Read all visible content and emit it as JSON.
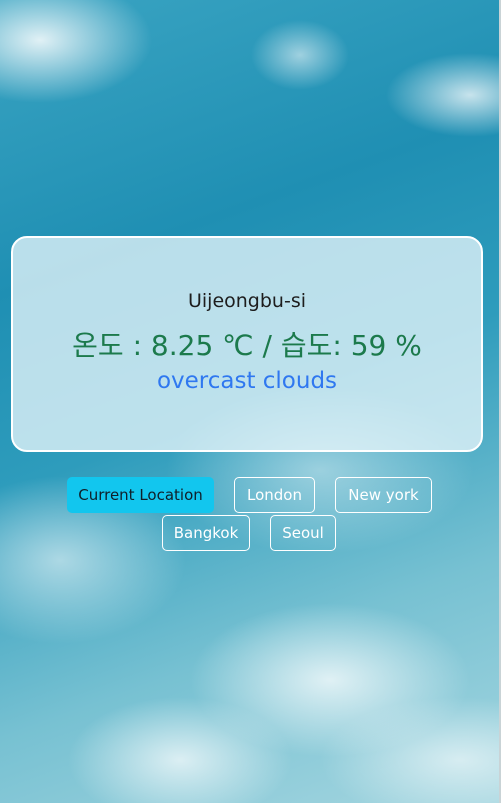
{
  "weather": {
    "city": "Uijeongbu-si",
    "temperature_line": "온도 : 8.25 ℃ / 습도: 59 %",
    "description": "overcast clouds"
  },
  "buttons": [
    {
      "label": "Current Location",
      "active": true
    },
    {
      "label": "London",
      "active": false
    },
    {
      "label": "New york",
      "active": false
    },
    {
      "label": "Bangkok",
      "active": false
    },
    {
      "label": "Seoul",
      "active": false
    }
  ],
  "colors": {
    "active_button": "#12c6ee",
    "temperature_text": "#1c7a4c",
    "description_text": "#2f78f0"
  }
}
